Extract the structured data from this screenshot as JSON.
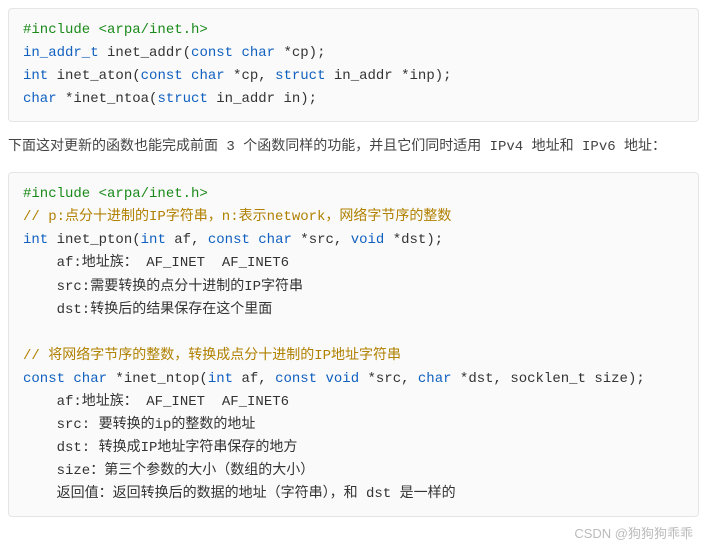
{
  "block1": {
    "l1_include": "#include <arpa/inet.h>",
    "l2_t1": "in_addr_t",
    "l2_t2": " inet_addr(",
    "l2_t3": "const char",
    "l2_t4": " *cp);",
    "l3_t1": "int",
    "l3_t2": " inet_aton(",
    "l3_t3": "const char",
    "l3_t4": " *cp, ",
    "l3_t5": "struct",
    "l3_t6": " in_addr *inp);",
    "l4_t1": "char",
    "l4_t2": " *inet_ntoa(",
    "l4_t3": "struct",
    "l4_t4": " in_addr in);"
  },
  "para1": "下面这对更新的函数也能完成前面 3 个函数同样的功能，并且它们同时适用 IPv4 地址和 IPv6 地址：",
  "block2": {
    "l1_include": "#include <arpa/inet.h>",
    "c1": "// p:点分十进制的IP字符串，n:表示network，网络字节序的整数",
    "l3_t1": "int",
    "l3_t2": " inet_pton(",
    "l3_t3": "int",
    "l3_t4": " af, ",
    "l3_t5": "const char",
    "l3_t6": " *src, ",
    "l3_t7": "void",
    "l3_t8": " *dst);",
    "l4": "    af:地址族： AF_INET  AF_INET6",
    "l5": "    src:需要转换的点分十进制的IP字符串",
    "l6": "    dst:转换后的结果保存在这个里面",
    "blank": "",
    "c2": "// 将网络字节序的整数，转换成点分十进制的IP地址字符串",
    "l9_t1": "const char",
    "l9_t2": " *inet_ntop(",
    "l9_t3": "int",
    "l9_t4": " af, ",
    "l9_t5": "const void",
    "l9_t6": " *src, ",
    "l9_t7": "char",
    "l9_t8": " *dst, socklen_t size);",
    "l10": "    af:地址族： AF_INET  AF_INET6",
    "l11": "    src: 要转换的ip的整数的地址",
    "l12": "    dst: 转换成IP地址字符串保存的地方",
    "l13": "    size：第三个参数的大小（数组的大小）",
    "l14": "    返回值：返回转换后的数据的地址（字符串），和 dst 是一样的"
  },
  "watermark": "CSDN @狗狗狗乖乖"
}
